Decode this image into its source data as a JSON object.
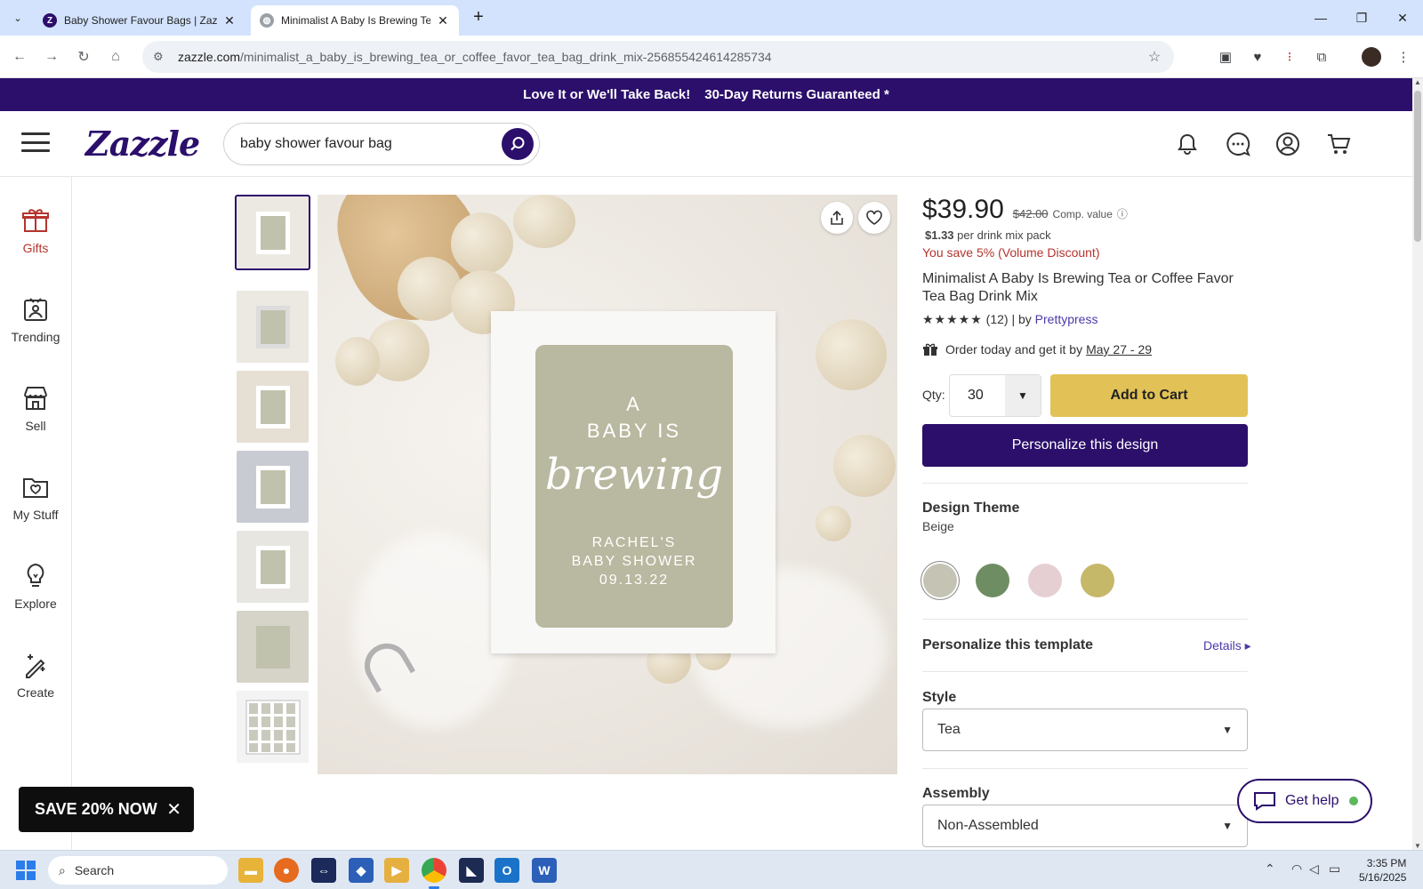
{
  "browser": {
    "tabs": [
      {
        "title": "Baby Shower Favour Bags | Zazzle",
        "active": false
      },
      {
        "title": "Minimalist A Baby Is Brewing Tea or Coffee Favor Tea Bag Drink Mix",
        "active": true
      }
    ],
    "url_domain": "zazzle.com",
    "url_path": "/minimalist_a_baby_is_brewing_tea_or_coffee_favor_tea_bag_drink_mix-256855424614285734"
  },
  "promo": {
    "left": "Love It or We'll Take Back!",
    "right": "30-Day Returns Guaranteed *"
  },
  "header": {
    "logo": "Zazzle",
    "search_value": "baby shower favour bag"
  },
  "left_rail": [
    {
      "label": "Gifts",
      "icon": "gift-icon"
    },
    {
      "label": "Trending",
      "icon": "trending-icon"
    },
    {
      "label": "Sell",
      "icon": "store-icon"
    },
    {
      "label": "My Stuff",
      "icon": "folder-icon"
    },
    {
      "label": "Explore",
      "icon": "lightbulb-icon"
    },
    {
      "label": "Create",
      "icon": "create-icon"
    }
  ],
  "product": {
    "price": "$39.90",
    "compare_price": "$42.00",
    "compare_note": "Comp. value",
    "unit_price": "$1.33",
    "unit_note": "per drink mix pack",
    "savings": "You save 5% (Volume Discount)",
    "title": "Minimalist A Baby Is Brewing Tea or Coffee Favor Tea Bag Drink Mix",
    "stars": "★★★★★",
    "review_count": "(12)",
    "by_prefix": "| by",
    "designer": "Prettypress",
    "delivery_prefix": "Order today and get it by",
    "delivery_date": "May 27 - 29",
    "qty_label": "Qty:",
    "qty_value": "30",
    "add_to_cart": "Add to Cart",
    "personalize_button": "Personalize this design",
    "design_theme_title": "Design Theme",
    "design_theme_value": "Beige",
    "swatches": [
      "#c5c3b3",
      "#6f8d63",
      "#e5cfd3",
      "#c6b869"
    ],
    "template_title": "Personalize this template",
    "details_link": "Details ▸",
    "style_title": "Style",
    "style_value": "Tea",
    "assembly_title": "Assembly",
    "assembly_value": "Non-Assembled"
  },
  "label_art": {
    "line1": "A",
    "line2": "BABY IS",
    "script": "brewing",
    "line3": "RACHEL'S",
    "line4": "BABY SHOWER",
    "line5": "09.13.22"
  },
  "floating": {
    "get_help": "Get help",
    "save_now": "SAVE 20% NOW"
  },
  "taskbar": {
    "search_placeholder": "Search",
    "time": "3:35 PM",
    "date": "5/16/2025"
  }
}
